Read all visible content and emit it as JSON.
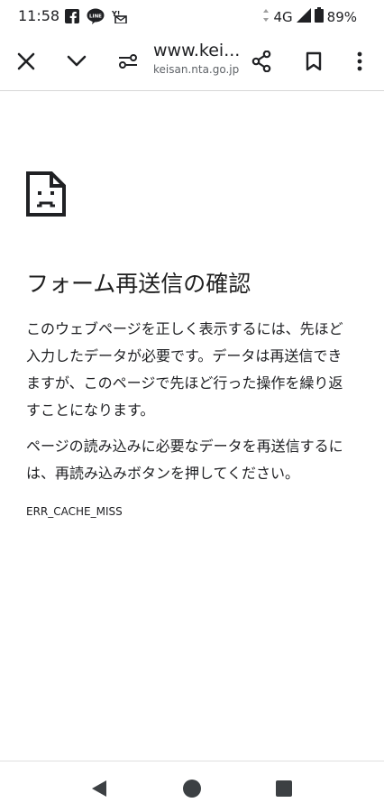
{
  "status_bar": {
    "time": "11:58",
    "network": "4G",
    "battery": "89%",
    "left_icons": [
      "facebook-icon",
      "line-icon",
      "yahoo-mail-icon"
    ]
  },
  "toolbar": {
    "url_title": "www.kei...",
    "url_domain": "keisan.nta.go.jp"
  },
  "error_page": {
    "heading": "フォーム再送信の確認",
    "paragraph1": "このウェブページを正しく表示するには、先ほど入力したデータが必要です。データは再送信できますが、このページで先ほど行った操作を繰り返すことになります。",
    "paragraph2": "ページの読み込みに必要なデータを再送信するには、再読み込みボタンを押してください。",
    "error_code": "ERR_CACHE_MISS"
  }
}
